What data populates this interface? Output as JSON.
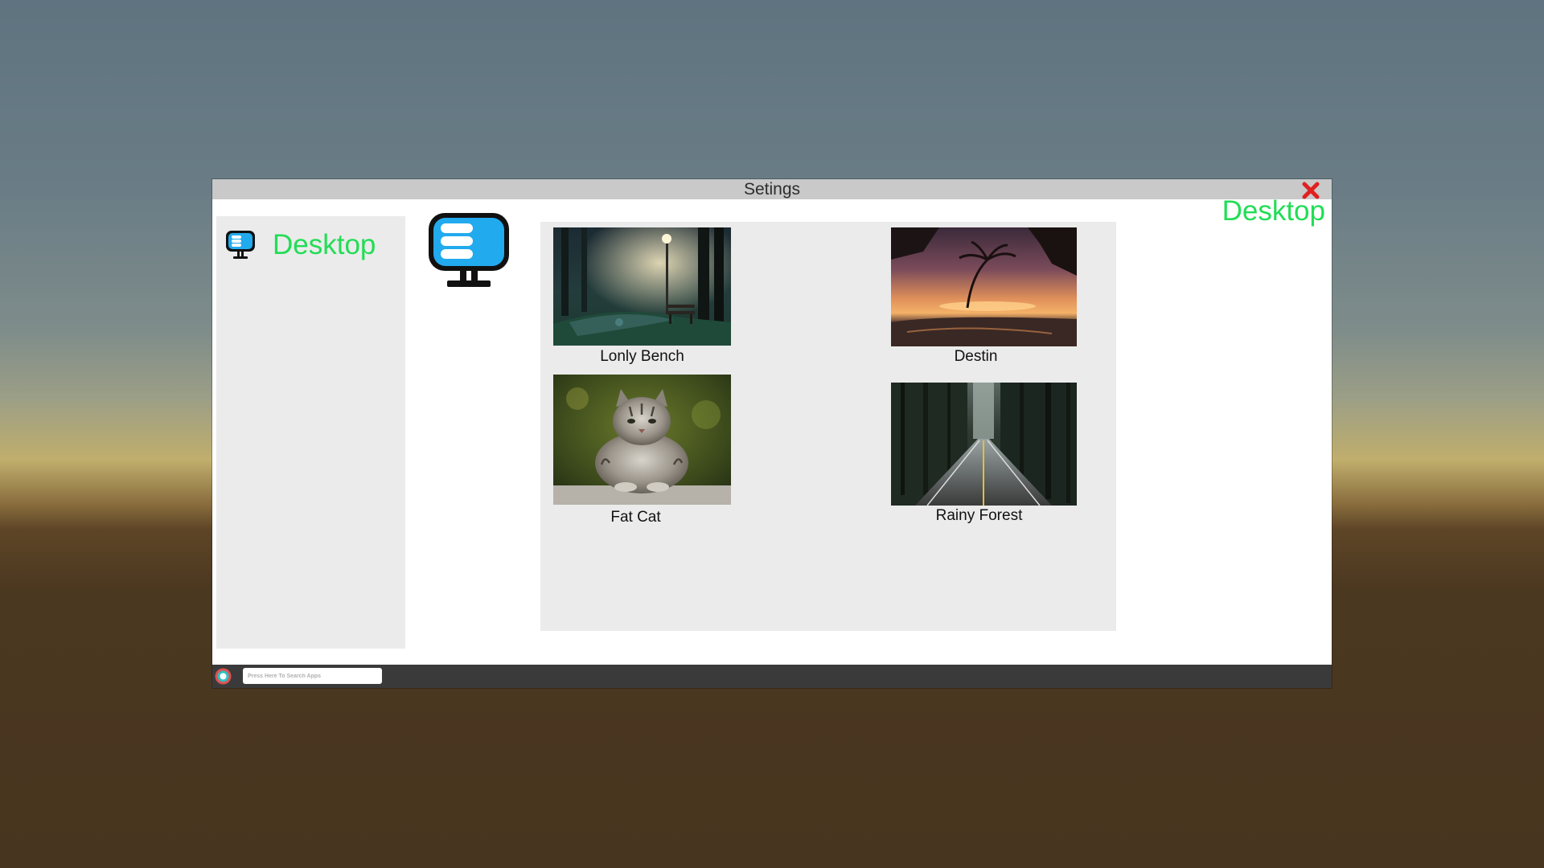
{
  "window": {
    "title": "Setings",
    "close_icon": "close-icon",
    "header_label": "Desktop"
  },
  "sidebar": {
    "items": [
      {
        "label": "Desktop",
        "icon": "monitor-icon"
      }
    ]
  },
  "main": {
    "hero_icon": "monitor-icon",
    "wallpapers": [
      {
        "label": "Lonly Bench",
        "icon": "night-park-bench-image"
      },
      {
        "label": "Destin",
        "icon": "sunset-beach-palm-image"
      },
      {
        "label": "Fat Cat",
        "icon": "tabby-cat-image"
      },
      {
        "label": "Rainy Forest",
        "icon": "forest-road-image"
      }
    ]
  },
  "taskbar": {
    "start_icon": "start-orb-icon",
    "search_placeholder": "Press Here To Search Apps",
    "search_value": ""
  },
  "colors": {
    "accent_green": "#22dd55",
    "close_red": "#e02020",
    "monitor_blue": "#22aaee",
    "taskbar": "#3a3a3a",
    "panel": "#ebebeb"
  }
}
